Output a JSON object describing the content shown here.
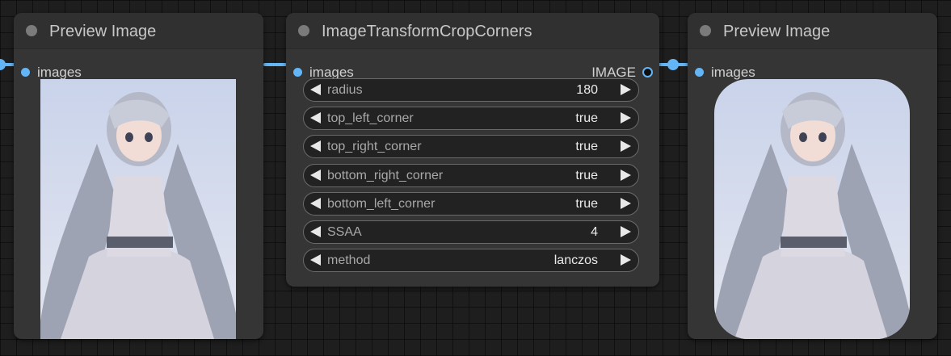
{
  "nodes": {
    "preview_left": {
      "title": "Preview Image",
      "input": "images"
    },
    "crop": {
      "title": "ImageTransformCropCorners",
      "input": "images",
      "output": "IMAGE",
      "widgets": [
        {
          "name": "radius",
          "value": "180"
        },
        {
          "name": "top_left_corner",
          "value": "true"
        },
        {
          "name": "top_right_corner",
          "value": "true"
        },
        {
          "name": "bottom_right_corner",
          "value": "true"
        },
        {
          "name": "bottom_left_corner",
          "value": "true"
        },
        {
          "name": "SSAA",
          "value": "4"
        },
        {
          "name": "method",
          "value": "lanczos"
        }
      ]
    },
    "preview_right": {
      "title": "Preview Image",
      "input": "images"
    }
  },
  "colors": {
    "link": "#64b5f6",
    "node_bg": "#353535",
    "canvas_bg": "#1e1e1e"
  },
  "icons": {
    "widget_decrement": "triangle-left-icon",
    "widget_increment": "triangle-right-icon"
  }
}
